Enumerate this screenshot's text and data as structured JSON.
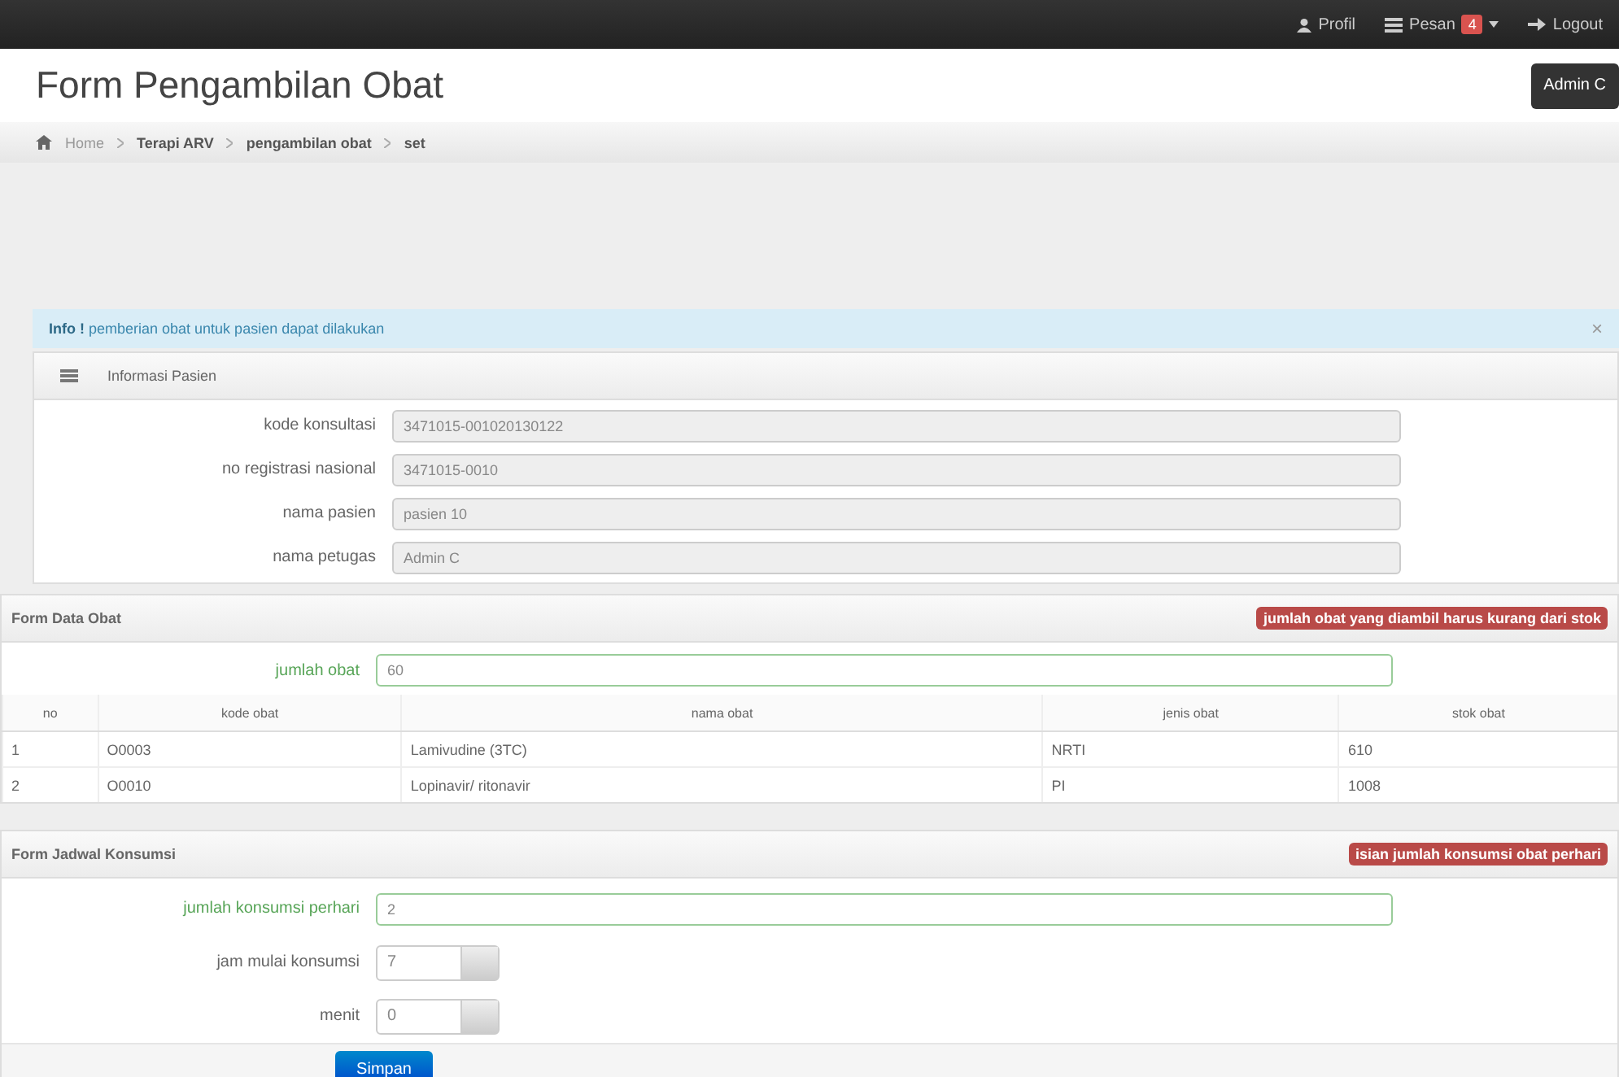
{
  "top_nav": [
    {
      "label": "Profil"
    },
    {
      "label": "Pesan",
      "badge": "4"
    },
    {
      "label": "Logout"
    }
  ],
  "page": {
    "title": "Form Pengambilan Obat",
    "user_button": "Admin C"
  },
  "breadcrumb": [
    "Home",
    "Terapi ARV",
    "pengambilan obat",
    "set"
  ],
  "alert": {
    "strong": "Info !",
    "message": "pemberian obat untuk pasien dapat dilakukan",
    "close": "×"
  },
  "patient_panel": {
    "title": "Informasi Pasien",
    "fields": [
      {
        "label": "kode konsultasi",
        "value": "3471015-001020130122",
        "kind": "readonly",
        "valid": false
      },
      {
        "label": "no registrasi nasional",
        "value": "3471015-0010",
        "kind": "readonly",
        "valid": false
      },
      {
        "label": "nama pasien",
        "value": "pasien 10",
        "kind": "readonly",
        "valid": false
      },
      {
        "label": "nama petugas",
        "value": "Admin C",
        "kind": "readonly",
        "valid": false
      }
    ]
  },
  "drug_panel": {
    "title": "Form Data Obat",
    "badge": "jumlah obat yang diambil harus kurang dari stok",
    "fields": [
      {
        "label": "jumlah obat",
        "value": "60",
        "kind": "input",
        "valid": true
      }
    ],
    "table": {
      "columns": [
        "no",
        "kode obat",
        "nama obat",
        "jenis obat",
        "stok obat"
      ],
      "rows": [
        [
          "1",
          "O0003",
          "Lamivudine (3TC)",
          "NRTI",
          "610"
        ],
        [
          "2",
          "O0010",
          "Lopinavir/ ritonavir",
          "PI",
          "1008"
        ]
      ]
    }
  },
  "schedule_panel": {
    "title": "Form Jadwal Konsumsi",
    "badge": "isian jumlah konsumsi obat perhari",
    "fields": [
      {
        "label": "jumlah konsumsi perhari",
        "value": "2",
        "kind": "input",
        "valid": true
      },
      {
        "label": "jam mulai konsumsi",
        "value": "7",
        "kind": "select",
        "valid": false
      },
      {
        "label": "menit",
        "value": "0",
        "kind": "select",
        "valid": false
      }
    ],
    "submit": "Simpan"
  }
}
